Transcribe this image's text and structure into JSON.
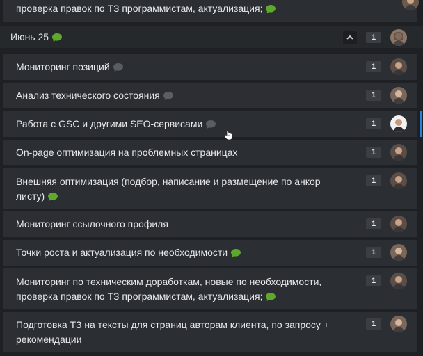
{
  "colors": {
    "bubble_active": "#5fa82b",
    "bubble_inactive": "#5a5e63",
    "accent": "#2f7fd8"
  },
  "top_partial": {
    "title": "проверка правок по ТЗ программистам, актуализация;",
    "comment_icon": "chat-bubble-green"
  },
  "group": {
    "title": "Июнь 25",
    "count": "1",
    "comment_icon": "chat-bubble-green",
    "collapse_icon": "chevron-up-icon"
  },
  "tasks": [
    {
      "title": "Мониторинг позиций",
      "count": "1",
      "icon": "chat-bubble-gray"
    },
    {
      "title": "Анализ технического состояния",
      "count": "1",
      "icon": "chat-bubble-gray"
    },
    {
      "title": "Работа с GSC и другими SEO-сервисами",
      "count": "1",
      "icon": "chat-bubble-gray"
    },
    {
      "title": "On-page оптимизация на проблемных страницах",
      "count": "1",
      "icon": ""
    },
    {
      "title": "Внешняя оптимизация (подбор, написание и размещение по анкор листу)",
      "count": "1",
      "icon": "chat-bubble-green"
    },
    {
      "title": "Мониторинг ссылочного профиля",
      "count": "1",
      "icon": ""
    },
    {
      "title": "Точки роста и актуализация по необходимости",
      "count": "1",
      "icon": "chat-bubble-green"
    },
    {
      "title": "Мониторинг по техническим доработкам, новые по необходимости, проверка правок по ТЗ программистам, актуализация;",
      "count": "1",
      "icon": "chat-bubble-green"
    },
    {
      "title": "Подготовка ТЗ на тексты для страниц авторам клиента, по запросу + рекомендации",
      "count": "1",
      "icon": ""
    }
  ]
}
